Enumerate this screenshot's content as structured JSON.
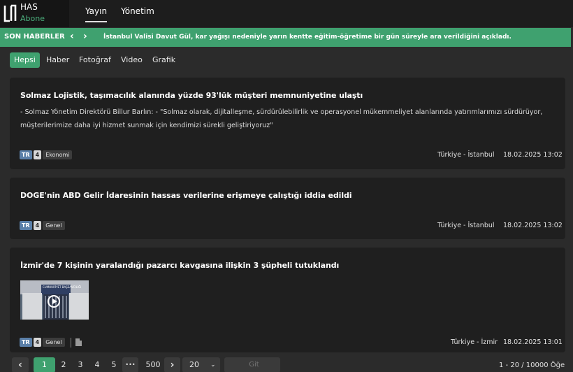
{
  "brand": {
    "name": "HAS",
    "subtitle": "Abone"
  },
  "topnav": [
    "Yayın",
    "Yönetim"
  ],
  "ticker": {
    "label": "SON HABERLER",
    "prev": "‹",
    "next": "›",
    "text": "İstanbul Valisi Davut Gül, kar yağışı nedeniyle yarın kentte eğitim-öğretime bir gün süreyle ara verildiğini açıkladı."
  },
  "filters": [
    "Hepsi",
    "Haber",
    "Fotoğraf",
    "Video",
    "Grafik"
  ],
  "news": [
    {
      "title": "Solmaz Lojistik, taşımacılık alanında yüzde 93'lük müşteri memnuniyetine ulaştı",
      "body": "- Solmaz Yönetim Direktörü Billur Barlın: - \"Solmaz olarak, dijitalleşme, sürdürülebilirlik ve operasyonel mükemmeliyet alanlarında yatırımlarımızı sürdürüyor, müşterilerimize daha iyi hizmet sunmak için kendimizi sürekli geliştiriyoruz\"",
      "lang": "TR",
      "priority": "4",
      "category": "Ekonomi",
      "location": "Türkiye - İstanbul",
      "date": "18.02.2025 13:02"
    },
    {
      "title": "DOGE'nin ABD Gelir İdaresinin hassas verilerine erişmeye çalıştığı iddia edildi",
      "lang": "TR",
      "priority": "4",
      "category": "Genel",
      "location": "Türkiye - İstanbul",
      "date": "18.02.2025 13:02"
    },
    {
      "title": "İzmir'de 7 kişinin yaralandığı pazarcı kavgasına ilişkin 3 şüpheli tutuklandı",
      "lang": "TR",
      "priority": "4",
      "category": "Genel",
      "location": "Türkiye - İzmir",
      "date": "18.02.2025 13:01",
      "thumb_text": "CUMHURİYET BAŞSAVCILIĞI",
      "thumb_icon": "play-circle-icon"
    }
  ],
  "pagination": {
    "prev": "‹",
    "next": "›",
    "pages": [
      "1",
      "2",
      "3",
      "4",
      "5"
    ],
    "ellipsis": "•••",
    "last": "500",
    "current": "1",
    "page_size": "20",
    "goto_placeholder": "Git",
    "summary": "1 - 20 / 10000 Öğe"
  },
  "colors": {
    "accent": "#3fa16f",
    "background": "#2b2b2b",
    "card": "#1f1f1f",
    "tag_tr": "#5a7fa8"
  }
}
